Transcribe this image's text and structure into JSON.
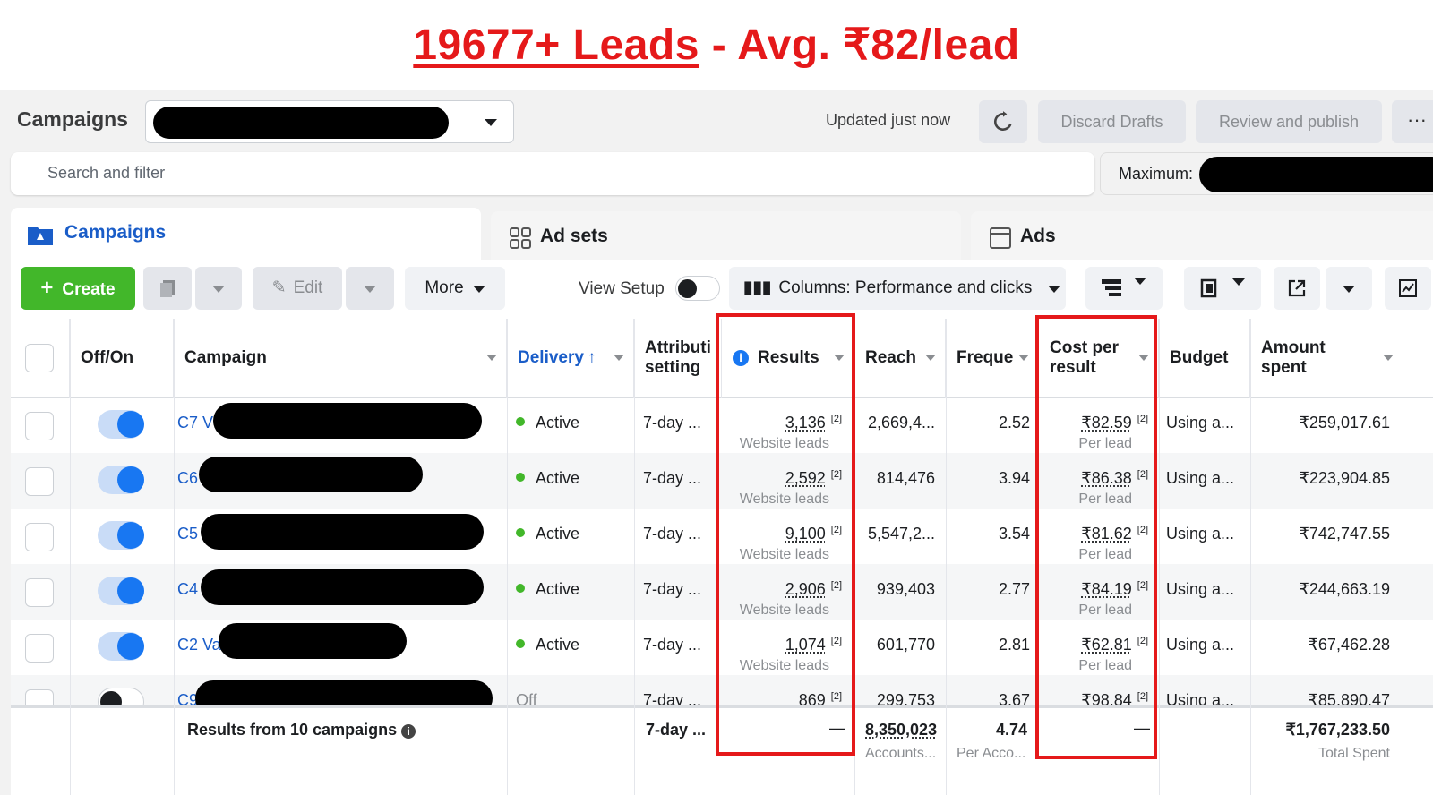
{
  "banner": {
    "leads": "19677+ Leads",
    "rest": " - Avg. ₹82/lead"
  },
  "header": {
    "title": "Campaigns",
    "updated": "Updated just now",
    "discard": "Discard Drafts",
    "review": "Review and publish",
    "more_dots": "···"
  },
  "search": {
    "placeholder": "Search and filter",
    "maximum_label": "Maximum:"
  },
  "tabs": [
    {
      "label": "Campaigns"
    },
    {
      "label": "Ad sets"
    },
    {
      "label": "Ads"
    }
  ],
  "toolbar": {
    "create": "Create",
    "edit": "Edit",
    "more": "More",
    "view_setup": "View Setup",
    "columns": "Columns: Performance and clicks"
  },
  "columns": {
    "offon": "Off/On",
    "campaign": "Campaign",
    "delivery": "Delivery",
    "attribution": "Attributi setting",
    "results": "Results",
    "reach": "Reach",
    "frequency": "Freque",
    "cpr": "Cost per result",
    "budget": "Budget",
    "amount": "Amount spent"
  },
  "rows": [
    {
      "name": "C7 V",
      "on": true,
      "delivery": "Active",
      "attr": "7-day ...",
      "results": "3,136",
      "results_sub": "Website leads",
      "reach": "2,669,4...",
      "freq": "2.52",
      "cpr": "₹82.59",
      "cpr_sub": "Per lead",
      "budget": "Using a...",
      "amount": "₹259,017.61"
    },
    {
      "name": "C6",
      "on": true,
      "delivery": "Active",
      "attr": "7-day ...",
      "results": "2,592",
      "results_sub": "Website leads",
      "reach": "814,476",
      "freq": "3.94",
      "cpr": "₹86.38",
      "cpr_sub": "Per lead",
      "budget": "Using a...",
      "amount": "₹223,904.85"
    },
    {
      "name": "C5",
      "on": true,
      "delivery": "Active",
      "attr": "7-day ...",
      "results": "9,100",
      "results_sub": "Website leads",
      "reach": "5,547,2...",
      "freq": "3.54",
      "cpr": "₹81.62",
      "cpr_sub": "Per lead",
      "budget": "Using a...",
      "amount": "₹742,747.55"
    },
    {
      "name": "C4",
      "on": true,
      "delivery": "Active",
      "attr": "7-day ...",
      "results": "2,906",
      "results_sub": "Website leads",
      "reach": "939,403",
      "freq": "2.77",
      "cpr": "₹84.19",
      "cpr_sub": "Per lead",
      "budget": "Using a...",
      "amount": "₹244,663.19"
    },
    {
      "name": "C2 Va",
      "on": true,
      "delivery": "Active",
      "attr": "7-day ...",
      "results": "1,074",
      "results_sub": "Website leads",
      "reach": "601,770",
      "freq": "2.81",
      "cpr": "₹62.81",
      "cpr_sub": "Per lead",
      "budget": "Using a...",
      "amount": "₹67,462.28"
    },
    {
      "name": "C9",
      "on": false,
      "delivery": "Off",
      "attr": "7-day ...",
      "results": "869",
      "results_sub": "",
      "reach": "299,753",
      "freq": "3.67",
      "cpr": "₹98.84",
      "cpr_sub": "",
      "budget": "Using a...",
      "amount": "₹85,890.47"
    }
  ],
  "footer": {
    "label": "Results from 10 campaigns",
    "attr": "7-day ...",
    "results": "—",
    "reach": "8,350,023",
    "reach_sub": "Accounts...",
    "freq": "4.74",
    "freq_sub": "Per Acco...",
    "cpr": "—",
    "amount": "₹1,767,233.50",
    "amount_sub": "Total Spent"
  },
  "superscript": "[2]",
  "colors": {
    "accent_red": "#e5191a",
    "link_blue": "#1a5dc8",
    "create_green": "#42b72a",
    "toggle_blue": "#1877f2"
  }
}
